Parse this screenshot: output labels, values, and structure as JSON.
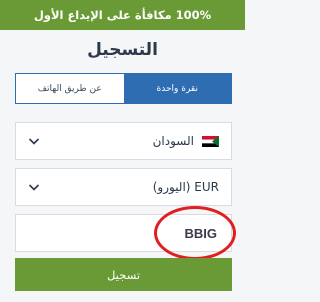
{
  "banner": {
    "text": "100% مكافأة على الإيداع الأول"
  },
  "form": {
    "title": "التسجيل",
    "tabs": [
      {
        "label": "عن طريق الهاتف",
        "active": false
      },
      {
        "label": "نقرة واحدة",
        "active": true
      }
    ],
    "country": {
      "value": "السودان",
      "flag_icon": "sudan-flag-icon"
    },
    "currency": {
      "value": "EUR (اليورو)"
    },
    "promo_code": {
      "value": "BBIG"
    },
    "submit_label": "تسجيل"
  },
  "colors": {
    "green": "#6a9a36",
    "blue": "#2f6db3",
    "highlight_red": "#e02020"
  }
}
